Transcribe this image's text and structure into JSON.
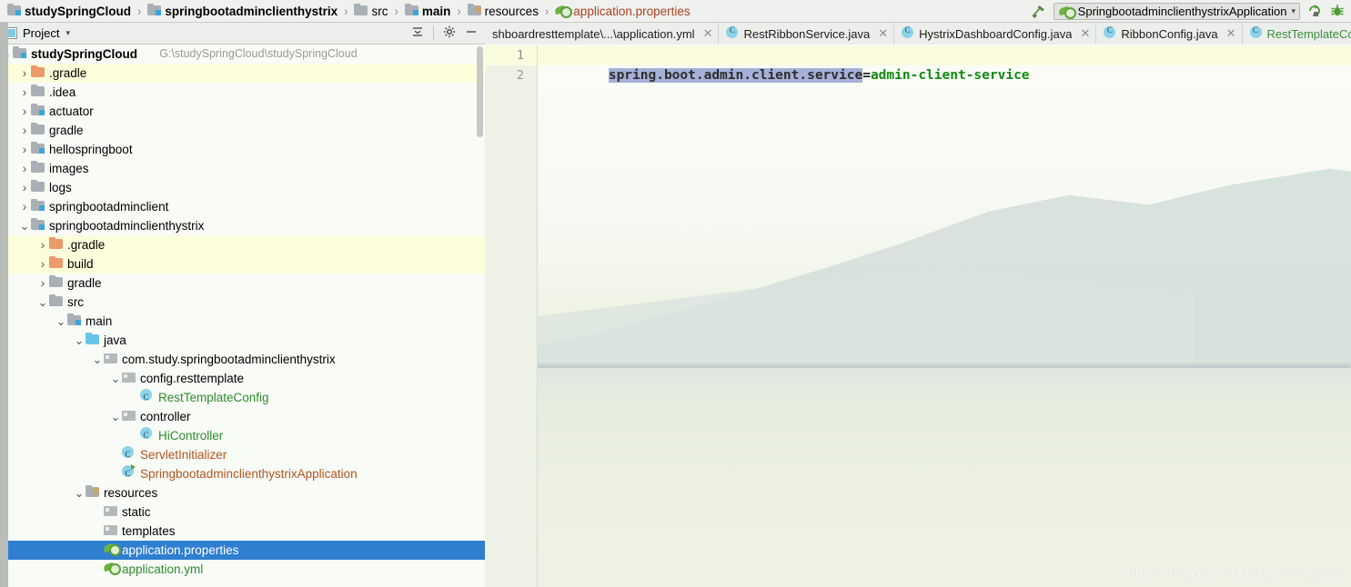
{
  "breadcrumb": {
    "items": [
      {
        "label": "studySpringCloud",
        "icon": "module-folder-icon",
        "style": "bold"
      },
      {
        "label": "springbootadminclienthystrix",
        "icon": "module-folder-icon",
        "style": "bold"
      },
      {
        "label": "src",
        "icon": "folder-icon",
        "style": "normal"
      },
      {
        "label": "main",
        "icon": "source-folder-icon",
        "style": "bold"
      },
      {
        "label": "resources",
        "icon": "resources-folder-icon",
        "style": "normal"
      },
      {
        "label": "application.properties",
        "icon": "spring-properties-icon",
        "style": "file"
      }
    ],
    "separator": "›"
  },
  "toolbar": {
    "build_icon": "hammer-icon",
    "run_configuration": "SpringbootadminclienthystrixApplication",
    "run_config_icon": "spring-boot-run-icon",
    "dropdown_icon": "chevron-down-icon",
    "rerun_icon": "rerun-icon",
    "debug_icon": "debug-icon"
  },
  "project_panel": {
    "title": "Project",
    "title_icon": "project-view-icon",
    "dropdown_icon": "chevron-down-icon",
    "collapse_all_icon": "collapse-all-icon",
    "settings_icon": "gear-icon",
    "hide_icon": "minimize-icon",
    "tree": [
      {
        "label": "studySpringCloud",
        "secondary": "G:\\studySpringCloud\\studySpringCloud",
        "depth": 0,
        "arrow": "expanded",
        "icon": "module-folder-icon",
        "color": "black",
        "bold": true,
        "highlight": "none"
      },
      {
        "label": ".gradle",
        "depth": 1,
        "arrow": "collapsed",
        "icon": "folder-orange-icon",
        "color": "black",
        "highlight": "yellow"
      },
      {
        "label": ".idea",
        "depth": 1,
        "arrow": "collapsed",
        "icon": "folder-icon",
        "color": "black",
        "highlight": "none"
      },
      {
        "label": "actuator",
        "depth": 1,
        "arrow": "collapsed",
        "icon": "module-folder-icon",
        "color": "black",
        "highlight": "none"
      },
      {
        "label": "gradle",
        "depth": 1,
        "arrow": "collapsed",
        "icon": "folder-icon",
        "color": "black",
        "highlight": "none"
      },
      {
        "label": "hellospringboot",
        "depth": 1,
        "arrow": "collapsed",
        "icon": "module-folder-icon",
        "color": "black",
        "highlight": "none"
      },
      {
        "label": "images",
        "depth": 1,
        "arrow": "collapsed",
        "icon": "folder-icon",
        "color": "black",
        "highlight": "none"
      },
      {
        "label": "logs",
        "depth": 1,
        "arrow": "collapsed",
        "icon": "folder-icon",
        "color": "black",
        "highlight": "none"
      },
      {
        "label": "springbootadminclient",
        "depth": 1,
        "arrow": "collapsed",
        "icon": "module-folder-icon",
        "color": "black",
        "highlight": "none"
      },
      {
        "label": "springbootadminclienthystrix",
        "depth": 1,
        "arrow": "expanded",
        "icon": "module-folder-icon",
        "color": "black",
        "highlight": "none"
      },
      {
        "label": ".gradle",
        "depth": 2,
        "arrow": "collapsed",
        "icon": "folder-orange-icon",
        "color": "black",
        "highlight": "yellow"
      },
      {
        "label": "build",
        "depth": 2,
        "arrow": "collapsed",
        "icon": "folder-orange-icon",
        "color": "black",
        "highlight": "yellow"
      },
      {
        "label": "gradle",
        "depth": 2,
        "arrow": "collapsed",
        "icon": "folder-icon",
        "color": "black",
        "highlight": "none"
      },
      {
        "label": "src",
        "depth": 2,
        "arrow": "expanded",
        "icon": "folder-icon",
        "color": "black",
        "highlight": "none"
      },
      {
        "label": "main",
        "depth": 3,
        "arrow": "expanded",
        "icon": "source-folder-icon",
        "color": "black",
        "highlight": "none"
      },
      {
        "label": "java",
        "depth": 4,
        "arrow": "expanded",
        "icon": "folder-blue-icon",
        "color": "black",
        "highlight": "none"
      },
      {
        "label": "com.study.springbootadminclienthystrix",
        "depth": 5,
        "arrow": "expanded",
        "icon": "package-icon",
        "color": "black",
        "highlight": "none"
      },
      {
        "label": "config.resttemplate",
        "depth": 6,
        "arrow": "expanded",
        "icon": "package-icon",
        "color": "black",
        "highlight": "none"
      },
      {
        "label": "RestTemplateConfig",
        "depth": 7,
        "arrow": "none",
        "icon": "java-class-icon",
        "color": "green",
        "highlight": "none"
      },
      {
        "label": "controller",
        "depth": 6,
        "arrow": "expanded",
        "icon": "package-icon",
        "color": "black",
        "highlight": "none"
      },
      {
        "label": "HiController",
        "depth": 7,
        "arrow": "none",
        "icon": "java-class-icon",
        "color": "green",
        "highlight": "none"
      },
      {
        "label": "ServletInitializer",
        "depth": 6,
        "arrow": "none",
        "icon": "java-class-icon",
        "color": "orange",
        "highlight": "none"
      },
      {
        "label": "SpringbootadminclienthystrixApplication",
        "depth": 6,
        "arrow": "none",
        "icon": "java-runnable-class-icon",
        "color": "orange",
        "highlight": "none"
      },
      {
        "label": "resources",
        "depth": 4,
        "arrow": "expanded",
        "icon": "resources-folder-icon",
        "color": "black",
        "highlight": "none"
      },
      {
        "label": "static",
        "depth": 5,
        "arrow": "none",
        "icon": "package-icon",
        "color": "black",
        "highlight": "none"
      },
      {
        "label": "templates",
        "depth": 5,
        "arrow": "none",
        "icon": "package-icon",
        "color": "black",
        "highlight": "none"
      },
      {
        "label": "application.properties",
        "depth": 5,
        "arrow": "none",
        "icon": "spring-properties-icon",
        "color": "white",
        "highlight": "selected"
      },
      {
        "label": "application.yml",
        "depth": 5,
        "arrow": "none",
        "icon": "spring-properties-icon",
        "color": "green",
        "highlight": "none"
      }
    ]
  },
  "editor": {
    "tabs": [
      {
        "label": "shboardresttemplate\\...\\application.yml",
        "icon": "none",
        "active": false,
        "color": "black",
        "close_icon": "close-icon"
      },
      {
        "label": "RestRibbonService.java",
        "icon": "java-class-icon",
        "active": false,
        "color": "black",
        "close_icon": "close-icon"
      },
      {
        "label": "HystrixDashboardConfig.java",
        "icon": "java-class-icon",
        "active": false,
        "color": "black",
        "close_icon": "close-icon"
      },
      {
        "label": "RibbonConfig.java",
        "icon": "java-class-icon",
        "active": false,
        "color": "black",
        "close_icon": "close-icon"
      },
      {
        "label": "RestTemplateConfig.",
        "icon": "java-class-icon",
        "active": false,
        "color": "green",
        "close_icon": "none"
      }
    ],
    "line_numbers": [
      "1",
      "2"
    ],
    "code": {
      "key": "spring.boot.admin.client.service",
      "operator": "=",
      "value": "admin-client-service"
    }
  },
  "watermark": "https://blog.csdn.net/a18792721831"
}
